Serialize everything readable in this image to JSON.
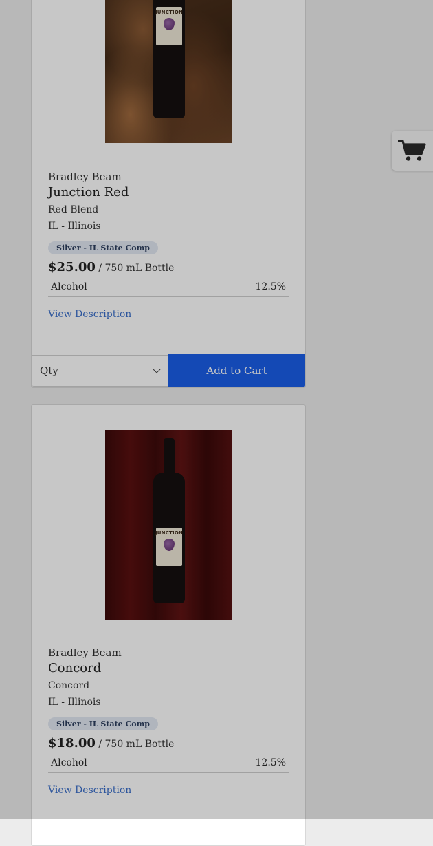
{
  "products": [
    {
      "producer": "Bradley Beam",
      "name": "Junction Red",
      "varietal": "Red Blend",
      "region": "IL - Illinois",
      "award": "Silver - IL State Comp",
      "price": "$25.00",
      "unit": "/ 750 mL Bottle",
      "stat_label": "Alcohol",
      "stat_value": "12.5%",
      "view_description": "View Description",
      "qty_label": "Qty",
      "add_to_cart": "Add to Cart",
      "image_label_text": "JUNCTION"
    },
    {
      "producer": "Bradley Beam",
      "name": "Concord",
      "varietal": "Concord",
      "region": "IL - Illinois",
      "award": "Silver - IL State Comp",
      "price": "$18.00",
      "unit": "/ 750 mL Bottle",
      "stat_label": "Alcohol",
      "stat_value": "12.5%",
      "view_description": "View Description",
      "image_label_text": "JUNCTION"
    }
  ],
  "cart_button": {
    "icon": "shopping-cart-icon"
  },
  "colors": {
    "accent": "#1a5ee8",
    "link": "#3b6fc9",
    "badge_bg": "#e2e8f2",
    "overlay": "rgba(0,0,0,0.22)"
  }
}
